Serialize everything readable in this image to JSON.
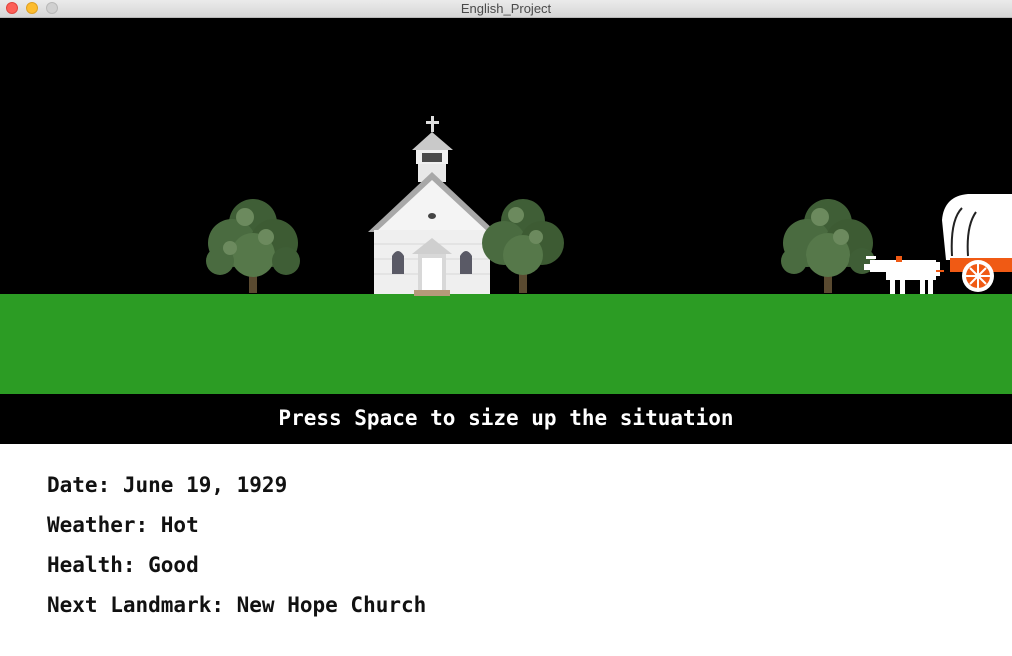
{
  "window": {
    "title": "English_Project"
  },
  "scene": {
    "prompt": "Press Space to size up the situation",
    "sprites": {
      "church": "church-icon",
      "trees": [
        "tree-icon",
        "tree-icon",
        "tree-icon"
      ],
      "wagon": "covered-wagon-icon",
      "ox": "ox-icon"
    },
    "colors": {
      "sky": "#000000",
      "ground": "#2c9c24",
      "wagon_accent": "#f05a14"
    }
  },
  "status": {
    "date": "Date: June 19, 1929",
    "weather": "Weather: Hot",
    "health": "Health: Good",
    "next_landmark": "Next Landmark: New Hope Church"
  }
}
